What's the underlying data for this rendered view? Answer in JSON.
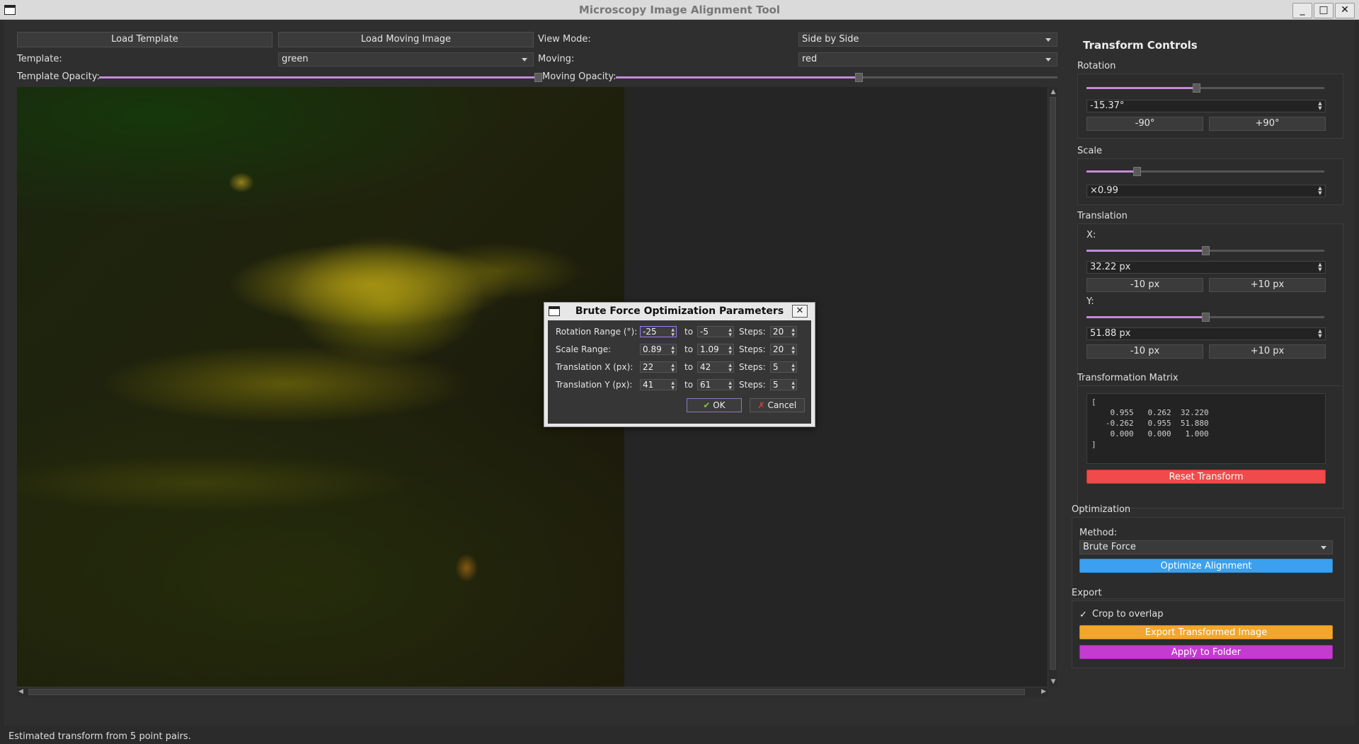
{
  "window": {
    "title": "Microscopy Image Alignment Tool"
  },
  "toolbar": {
    "load_template": "Load Template",
    "load_moving": "Load Moving Image",
    "view_mode_label": "View Mode:",
    "view_mode_value": "Side by Side",
    "template_label": "Template:",
    "template_value": "green",
    "moving_label": "Moving:",
    "moving_value": "red",
    "template_opacity_label": "Template Opacity:",
    "template_opacity": 1.0,
    "moving_opacity_label": "Moving Opacity:",
    "moving_opacity": 0.55
  },
  "transform": {
    "heading": "Transform Controls",
    "rotation": {
      "label": "Rotation",
      "value": "-15.37°",
      "minus": "-90°",
      "plus": "+90°",
      "level": 0.46
    },
    "scale": {
      "label": "Scale",
      "value": "×0.99",
      "level": 0.21
    },
    "translation": {
      "label": "Translation",
      "x_label": "X:",
      "x_value": "32.22 px",
      "x_level": 0.5,
      "y_label": "Y:",
      "y_value": "51.88 px",
      "y_level": 0.5,
      "minus": "-10 px",
      "plus": "+10 px"
    },
    "matrix": {
      "label": "Transformation Matrix",
      "text": "[\n    0.955   0.262  32.220\n   -0.262   0.955  51.880\n    0.000   0.000   1.000\n]"
    },
    "reset": "Reset Transform"
  },
  "optimization": {
    "label": "Optimization",
    "method_label": "Method:",
    "method_value": "Brute Force",
    "optimize": "Optimize Alignment"
  },
  "export": {
    "label": "Export",
    "crop_check": "✓",
    "crop_label": "Crop to overlap",
    "export_button": "Export Transformed Image",
    "apply_folder": "Apply to Folder"
  },
  "dialog": {
    "title": "Brute Force Optimization Parameters",
    "close": "✕",
    "to": "to",
    "steps": "Steps:",
    "rows": [
      {
        "label": "Rotation Range (°):",
        "from": "-25",
        "to": "-5",
        "steps": "20"
      },
      {
        "label": "Scale Range:",
        "from": "0.89",
        "to": "1.09",
        "steps": "20"
      },
      {
        "label": "Translation X (px):",
        "from": "22",
        "to": "42",
        "steps": "5"
      },
      {
        "label": "Translation Y (px):",
        "from": "41",
        "to": "61",
        "steps": "5"
      }
    ],
    "ok": "OK",
    "cancel": "Cancel"
  },
  "status": "Estimated transform from 5 point pairs.",
  "colors": {
    "slider_accent": "#c58ad8",
    "reset": "#f04a4a",
    "optimize": "#3aa0ef",
    "export": "#f2a62b",
    "apply": "#c43bd0"
  }
}
